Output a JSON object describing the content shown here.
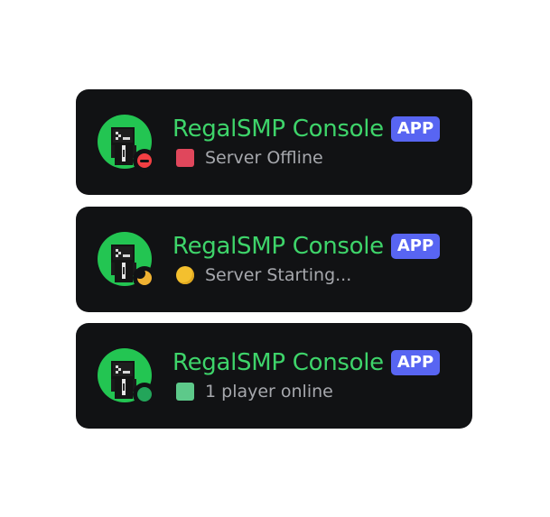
{
  "cards": [
    {
      "name": "RegalSMP Console",
      "badge": "APP",
      "presence": "do-not-disturb",
      "status_emoji": "red-square",
      "status_text": "Server Offline"
    },
    {
      "name": "RegalSMP Console",
      "badge": "APP",
      "presence": "idle",
      "status_emoji": "yellow-circle",
      "status_text": "Server Starting..."
    },
    {
      "name": "RegalSMP Console",
      "badge": "APP",
      "presence": "online",
      "status_emoji": "green-square",
      "status_text": "1 player online"
    }
  ],
  "colors": {
    "card_bg": "#111214",
    "name": "#3ed46a",
    "badge_bg": "#5865f2",
    "status_text": "#a6a8ad",
    "avatar_bg": "#23c552",
    "dnd": "#f23f43",
    "idle": "#f0b232",
    "online": "#23a55a"
  }
}
